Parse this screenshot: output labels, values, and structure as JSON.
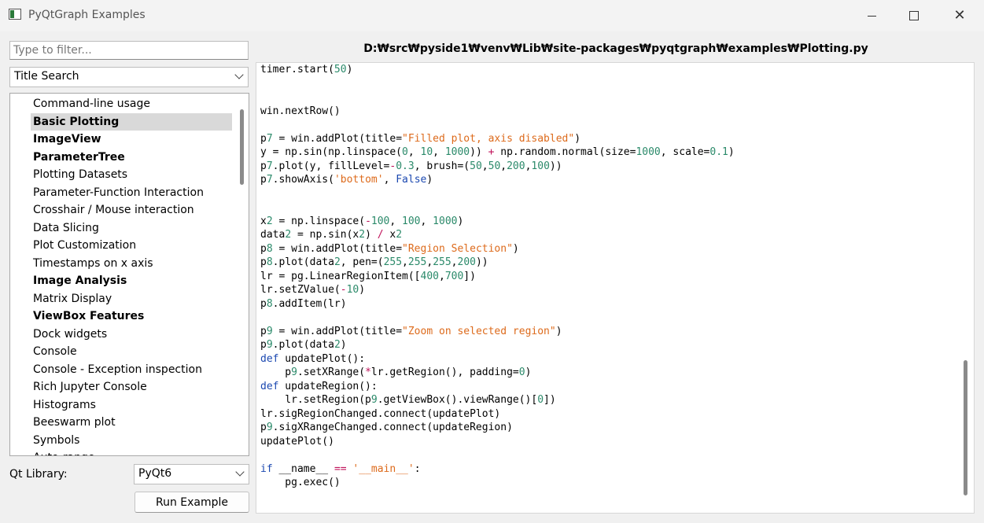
{
  "window": {
    "title": "PyQtGraph Examples"
  },
  "left_panel": {
    "filter_placeholder": "Type to filter...",
    "filter_value": "",
    "search_mode": "Title Search",
    "tree_items": [
      {
        "label": "Command-line usage",
        "bold": false,
        "selected": false
      },
      {
        "label": "Basic Plotting",
        "bold": true,
        "selected": true
      },
      {
        "label": "ImageView",
        "bold": true,
        "selected": false
      },
      {
        "label": "ParameterTree",
        "bold": true,
        "selected": false
      },
      {
        "label": "Plotting Datasets",
        "bold": false,
        "selected": false
      },
      {
        "label": "Parameter-Function Interaction",
        "bold": false,
        "selected": false
      },
      {
        "label": "Crosshair / Mouse interaction",
        "bold": false,
        "selected": false
      },
      {
        "label": "Data Slicing",
        "bold": false,
        "selected": false
      },
      {
        "label": "Plot Customization",
        "bold": false,
        "selected": false
      },
      {
        "label": "Timestamps on x axis",
        "bold": false,
        "selected": false
      },
      {
        "label": "Image Analysis",
        "bold": true,
        "selected": false
      },
      {
        "label": "Matrix Display",
        "bold": false,
        "selected": false
      },
      {
        "label": "ViewBox Features",
        "bold": true,
        "selected": false
      },
      {
        "label": "Dock widgets",
        "bold": false,
        "selected": false
      },
      {
        "label": "Console",
        "bold": false,
        "selected": false
      },
      {
        "label": "Console - Exception inspection",
        "bold": false,
        "selected": false
      },
      {
        "label": "Rich Jupyter Console",
        "bold": false,
        "selected": false
      },
      {
        "label": "Histograms",
        "bold": false,
        "selected": false
      },
      {
        "label": "Beeswarm plot",
        "bold": false,
        "selected": false
      },
      {
        "label": "Symbols",
        "bold": false,
        "selected": false
      },
      {
        "label": "Auto-range",
        "bold": false,
        "selected": false
      }
    ],
    "qt_library_label": "Qt Library:",
    "qt_library_value": "PyQt6",
    "run_button": "Run Example"
  },
  "editor": {
    "file_path": "D:₩src₩pyside1₩venv₩Lib₩site-packages₩pyqtgraph₩examples₩Plotting.py",
    "code_lines": [
      "timer.start(50)",
      "",
      "",
      "win.nextRow()",
      "",
      "p7 = win.addPlot(title=\"Filled plot, axis disabled\")",
      "y = np.sin(np.linspace(0, 10, 1000)) + np.random.normal(size=1000, scale=0.1)",
      "p7.plot(y, fillLevel=-0.3, brush=(50,50,200,100))",
      "p7.showAxis('bottom', False)",
      "",
      "",
      "x2 = np.linspace(-100, 100, 1000)",
      "data2 = np.sin(x2) / x2",
      "p8 = win.addPlot(title=\"Region Selection\")",
      "p8.plot(data2, pen=(255,255,255,200))",
      "lr = pg.LinearRegionItem([400,700])",
      "lr.setZValue(-10)",
      "p8.addItem(lr)",
      "",
      "p9 = win.addPlot(title=\"Zoom on selected region\")",
      "p9.plot(data2)",
      "def updatePlot():",
      "    p9.setXRange(*lr.getRegion(), padding=0)",
      "def updateRegion():",
      "    lr.setRegion(p9.getViewBox().viewRange()[0])",
      "lr.sigRegionChanged.connect(updatePlot)",
      "p9.sigXRangeChanged.connect(updateRegion)",
      "updatePlot()",
      "",
      "if __name__ == '__main__':",
      "    pg.exec()"
    ]
  },
  "colors": {
    "string": "#dd6a1b",
    "number": "#2b8a6a",
    "keyword": "#1b48b0",
    "operator": "#c0125a",
    "selection": "#d9d9d9"
  }
}
